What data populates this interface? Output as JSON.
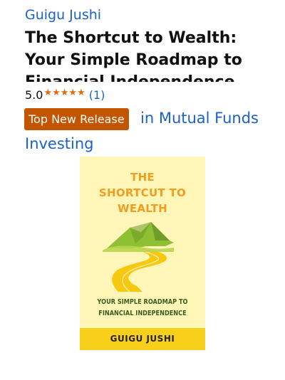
{
  "product": {
    "author": "Guigu Jushi",
    "title": "The Shortcut to Wealth: Your Simple Roadmap to Financial Independence",
    "rating": {
      "value": "5.0",
      "stars": 5,
      "count": "(1)"
    },
    "badge": {
      "label": "Top New Release",
      "category_line1": "in Mutual Funds",
      "category_line2": "Investing"
    },
    "cover": {
      "title_lines": [
        "THE",
        "SHORTCUT TO",
        "WEALTH"
      ],
      "subtitle_lines": [
        "YOUR SIMPLE ROADMAP TO",
        "FINANCIAL INDEPENDENCE"
      ],
      "author": "GUIGU JUSHI"
    }
  },
  "colors": {
    "link": "#1a62c6",
    "star": "#e26b0f",
    "badge_bg": "#c45500",
    "cover_bg": "#fff6b8",
    "cover_title": "#f39c1f",
    "cover_band": "#f8cf1a"
  },
  "icons": {
    "star": "star-icon"
  }
}
